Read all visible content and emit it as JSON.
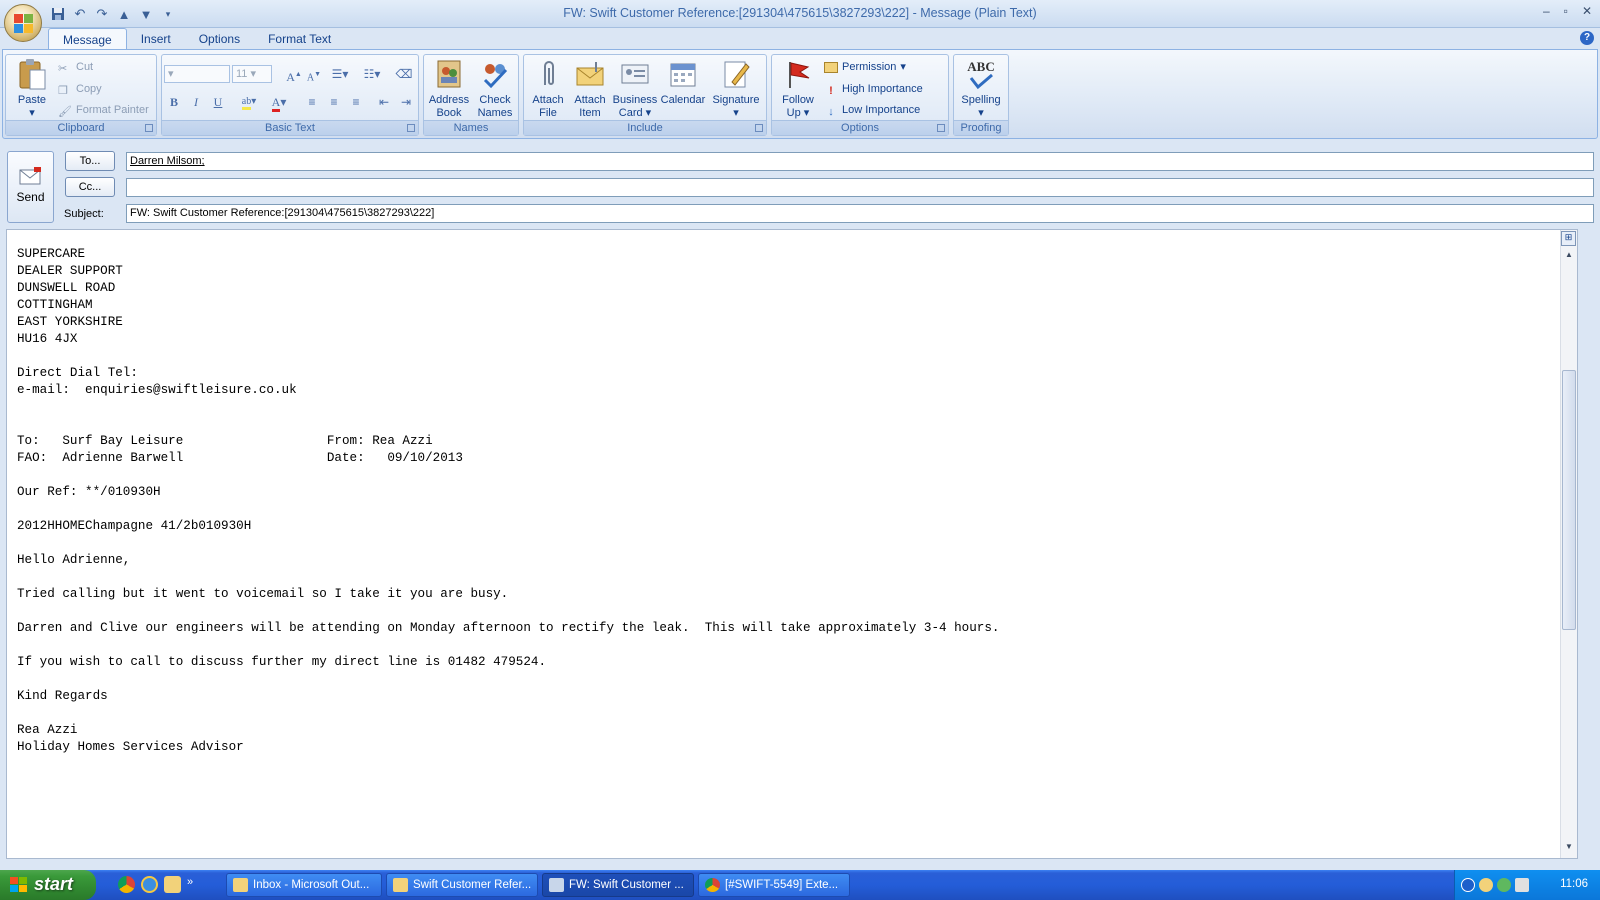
{
  "window": {
    "title": "FW: Swift Customer Reference:[291304\\475615\\3827293\\222] - Message (Plain Text)",
    "controls": [
      "–",
      "▫",
      "✕"
    ]
  },
  "ribbon": {
    "tabs": [
      "Message",
      "Insert",
      "Options",
      "Format Text"
    ],
    "clipboard": {
      "label": "Clipboard",
      "paste": "Paste",
      "cut": "Cut",
      "copy": "Copy",
      "format_painter": "Format Painter"
    },
    "basic_text": {
      "label": "Basic Text",
      "font_size": "11"
    },
    "names": {
      "label": "Names",
      "address_book_1": "Address",
      "address_book_2": "Book",
      "check_names_1": "Check",
      "check_names_2": "Names"
    },
    "include": {
      "label": "Include",
      "attach_file_1": "Attach",
      "attach_file_2": "File",
      "attach_item_1": "Attach",
      "attach_item_2": "Item",
      "business_card_1": "Business",
      "business_card_2": "Card",
      "calendar": "Calendar",
      "signature": "Signature"
    },
    "options": {
      "label": "Options",
      "follow_up_1": "Follow",
      "follow_up_2": "Up",
      "permission": "Permission",
      "high_importance": "High Importance",
      "low_importance": "Low Importance"
    },
    "proofing": {
      "label": "Proofing",
      "spelling": "Spelling",
      "abc": "ABC"
    }
  },
  "header": {
    "send": "Send",
    "to_button": "To...",
    "cc_button": "Cc...",
    "subject_label": "Subject:",
    "to_value": "Darren Milsom;",
    "cc_value": "",
    "subject_value": "FW: Swift Customer Reference:[291304\\475615\\3827293\\222]"
  },
  "body": {
    "text": "SUPERCARE\nDEALER SUPPORT\nDUNSWELL ROAD\nCOTTINGHAM\nEAST YORKSHIRE\nHU16 4JX\n\nDirect Dial Tel:\ne-mail:  enquiries@swiftleisure.co.uk\n\n\nTo:   Surf Bay Leisure                   From: Rea Azzi\nFAO:  Adrienne Barwell                   Date:   09/10/2013\n\nOur Ref: **/010930H\n\n2012HHOMEChampagne 41/2b010930H\n\nHello Adrienne,\n\nTried calling but it went to voicemail so I take it you are busy.\n\nDarren and Clive our engineers will be attending on Monday afternoon to rectify the leak.  This will take approximately 3-4 hours.\n\nIf you wish to call to discuss further my direct line is 01482 479524.\n\nKind Regards\n\nRea Azzi\nHoliday Homes Services Advisor"
  },
  "taskbar": {
    "start": "start",
    "tasks": [
      "Inbox - Microsoft Out...",
      "Swift Customer Refer...",
      "FW: Swift Customer ...",
      "[#SWIFT-5549] Exte..."
    ],
    "clock": "11:06"
  }
}
